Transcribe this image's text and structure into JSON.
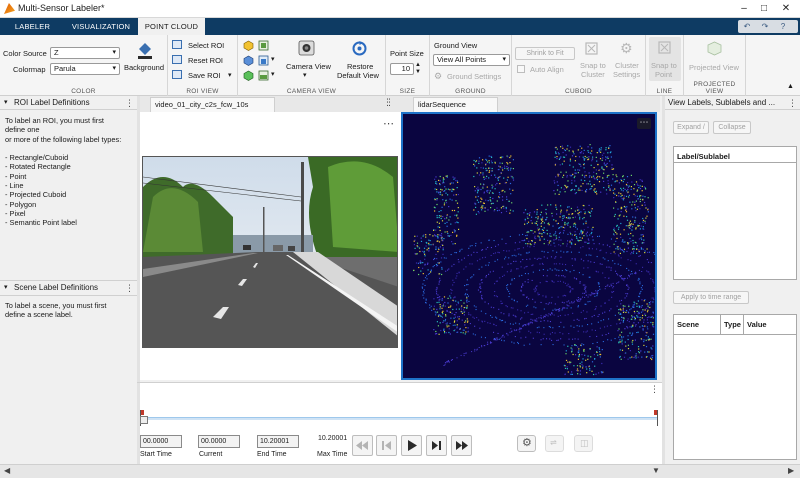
{
  "window": {
    "title": "Multi-Sensor Labeler*"
  },
  "tabs": [
    "LABELER",
    "VISUALIZATION",
    "POINT CLOUD"
  ],
  "toolstrip": {
    "color": {
      "section_label": "COLOR",
      "color_source_label": "Color Source",
      "color_source_value": "Z",
      "colormap_label": "Colormap",
      "colormap_value": "Parula",
      "background_label": "Background"
    },
    "roi_view": {
      "section_label": "ROI VIEW",
      "select_roi": "Select ROI",
      "reset_roi": "Reset ROI",
      "save_roi": "Save ROI"
    },
    "camera_view": {
      "section_label": "CAMERA VIEW",
      "camera_view_label": "Camera View",
      "restore_line1": "Restore",
      "restore_line2": "Default View"
    },
    "size": {
      "section_label": "SIZE",
      "point_size_label": "Point Size",
      "point_size_value": "10"
    },
    "ground": {
      "section_label": "GROUND",
      "ground_view_label": "Ground View",
      "ground_view_value": "View All Points",
      "ground_settings": "Ground Settings"
    },
    "cuboid": {
      "section_label": "CUBOID",
      "shrink_to_fit": "Shrink to Fit",
      "auto_align": "Auto Align",
      "snap_line1": "Snap to",
      "snap_line2": "Cluster",
      "cluster_line1": "Cluster",
      "cluster_line2": "Settings"
    },
    "line": {
      "section_label": "LINE",
      "snap_line1": "Snap to",
      "snap_line2": "Point"
    },
    "projected_view": {
      "section_label": "PROJECTED VIEW",
      "projected_view_label": "Projected View"
    }
  },
  "roi_panel": {
    "title": "ROI Label Definitions",
    "instructions": [
      "To label an ROI, you must first",
      "define one",
      "or more of the following label types:",
      "",
      "- Rectangle/Cuboid",
      "- Rotated Rectangle",
      "- Point",
      "- Line",
      "- Projected Cuboid",
      "- Polygon",
      "- Pixel",
      "- Semantic Point label"
    ]
  },
  "scene_panel": {
    "title": "Scene Label Definitions",
    "instructions": [
      "To label a scene, you must first",
      "define a scene label."
    ]
  },
  "signals": {
    "video_tab": "video_01_city_c2s_fcw_10s",
    "lidar_tab": "lidarSequence"
  },
  "playback": {
    "start_time": "00.0000",
    "start_label": "Start Time",
    "current_time": "00.0000",
    "current_label": "Current",
    "end_time": "10.20001",
    "end_label": "End Time",
    "max_time": "10.20001",
    "max_label": "Max Time"
  },
  "right_panel": {
    "title": "View Labels, Sublabels and ...",
    "expand": "Expand /",
    "collapse": "Collapse",
    "table1_header": "Label/Sublabel",
    "apply": "Apply to time range",
    "table2_headers": [
      "Scene",
      "Type",
      "Value"
    ]
  },
  "colors": {
    "tabstrip": "#0e3b63",
    "lidar_background": "#0a0540",
    "selection_border": "#1e73c8"
  }
}
